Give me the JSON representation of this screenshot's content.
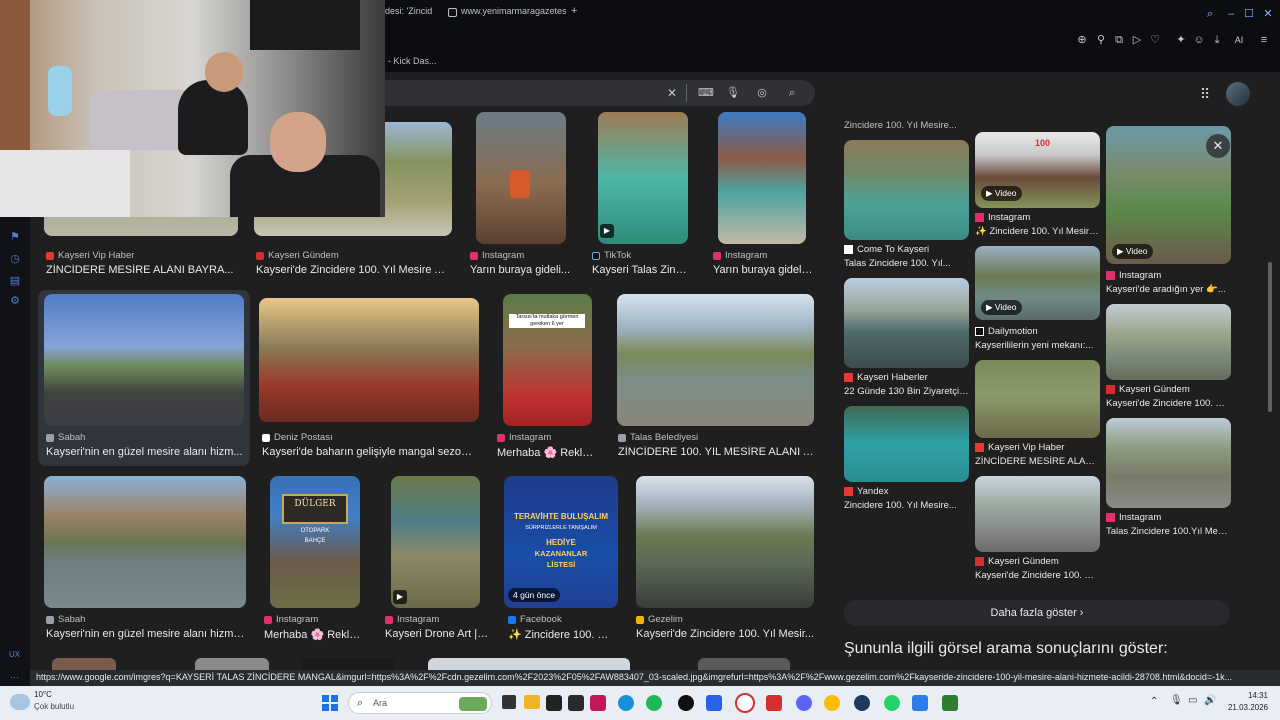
{
  "browser": {
    "tabs": [
      {
        "label": "desi: 'Zincid"
      },
      {
        "label": "www.yenimarmaragazetes"
      }
    ],
    "new_tab": "+",
    "toolbar_right": "AI",
    "bookmark": "- Kick Das..."
  },
  "search": {
    "placeholder": ""
  },
  "left_grid": {
    "row1": [
      {
        "source": "Kayseri Vip Haber",
        "title": "ZİNCİDERE MESİRE ALANI BAYRA..."
      },
      {
        "source": "Kayseri Gündem",
        "title": "Kayseri'de Zincidere 100. Yıl Mesire Al..."
      },
      {
        "source": "Instagram",
        "title": "Yarın buraya gideli..."
      },
      {
        "source": "TikTok",
        "title": "Kayseri Talas Zinci..."
      },
      {
        "source": "Instagram",
        "title": "Yarın buraya gideli..."
      }
    ],
    "row2": [
      {
        "source": "Sabah",
        "title": "Kayseri'nin en güzel mesire alanı hizm..."
      },
      {
        "source": "Deniz Postası",
        "title": "Kayseri'de baharın gelişiyle mangal sezonu..."
      },
      {
        "source": "Instagram",
        "title": "Merhaba 🌸 Rekla..."
      },
      {
        "source": "Talas Belediyesi",
        "title": "ZİNCİDERE 100. YIL MESİRE ALANI A..."
      }
    ],
    "row3": [
      {
        "source": "Sabah",
        "title": "Kayseri'nin en güzel mesire alanı hizme..."
      },
      {
        "source": "Instagram",
        "title": "Merhaba 🌸 Rekla..."
      },
      {
        "source": "Instagram",
        "title": "Kayseri Drone Art | ..."
      },
      {
        "source": "Facebook",
        "title": "✨ Zincidere 100. Yı..."
      },
      {
        "source": "Gezelim",
        "title": "Kayseri'de Zincidere 100. Yıl Mesir..."
      }
    ],
    "poster_text": {
      "line1": "TERAVİHTE BULUŞALIM",
      "line2": "SÜRPRİZLERLE TANIŞALIM",
      "line3": "HEDİYE",
      "line4": "KAZANANLAR",
      "line5": "LİSTESİ"
    },
    "badge_days": "4 gün önce",
    "sign_text": {
      "line1": "DÜLGER",
      "line2": "OTOPARK",
      "line3": "BAHÇE"
    },
    "overlay_text": "Tarsus'ta mutlaka görmen gereken 6 yer"
  },
  "right_panel": {
    "top_cut": "Zincidere 100. Yıl Mesire...",
    "col1": [
      {
        "source": "Come To Kayseri",
        "title": "Talas Zincidere 100. Yıl..."
      },
      {
        "source": "Kayseri Haberler",
        "title": "22 Günde 130 Bin Ziyaretçi ..."
      },
      {
        "source": "Yandex",
        "title": "Zincidere 100. Yıl Mesire..."
      }
    ],
    "col2": [
      {
        "source": "Instagram",
        "title": "✨ Zincidere 100. Yıl Mesire..."
      },
      {
        "source": "Dailymotion",
        "title": "Kayserililerin yeni mekanı:..."
      },
      {
        "source": "Kayseri Vip Haber",
        "title": "ZİNCİDERE MESİRE ALANI..."
      },
      {
        "source": "Kayseri Gündem",
        "title": "Kayseri'de Zincidere 100. Yı..."
      }
    ],
    "col3": [
      {
        "source": "Instagram",
        "title": "Kayseri'de aradığın yer 👉..."
      },
      {
        "source": "Kayseri Gündem",
        "title": "Kayseri'de Zincidere 100. Yı..."
      },
      {
        "source": "Instagram",
        "title": "Talas Zincidere 100.Yıl Mesi..."
      }
    ],
    "video_label": "Video",
    "logo_100": "100",
    "show_more": "Daha fazla göster",
    "related_heading": "Şununla ilgili görsel arama sonuçlarını göster:"
  },
  "status_url": "https://www.google.com/imgres?q=KAYSERİ TALAS ZİNCİDERE MANGAL&imgurl=https%3A%2F%2Fcdn.gezelim.com%2F2023%2F05%2FAW883407_03-scaled.jpg&imgrefurl=https%3A%2F%2Fwww.gezelim.com%2Fkayseride-zincidere-100-yil-mesire-alani-hizmete-acildi-28708.html&docid=-1k...",
  "sidebar_label": "UX",
  "taskbar": {
    "weather_temp": "10°C",
    "weather_desc": "Çok bulutlu",
    "search_label": "Ara",
    "time": "14:31",
    "date": "21.03.2026"
  },
  "colors": {
    "page_bg": "#1f1f1f",
    "chrome_bg": "#0c0d11",
    "accent": "#8ab4f8"
  }
}
